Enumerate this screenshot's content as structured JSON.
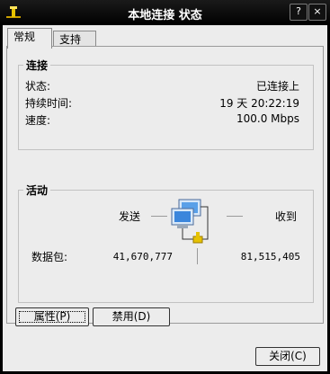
{
  "window": {
    "title": "本地连接 状态",
    "controls": {
      "help": "?",
      "close": "×"
    }
  },
  "tabs": [
    {
      "label": "常规",
      "active": true
    },
    {
      "label": "支持",
      "active": false
    }
  ],
  "connection": {
    "group_title": "连接",
    "status_label": "状态:",
    "status_value": "已连接上",
    "duration_label": "持续时间:",
    "duration_value": "19 天 20:22:19",
    "speed_label": "速度:",
    "speed_value": "100.0 Mbps"
  },
  "activity": {
    "group_title": "活动",
    "sent_label": "发送",
    "received_label": "收到",
    "packets_label": "数据包:",
    "packets_sent": "41,670,777",
    "packets_received": "81,515,405",
    "icon": "network-computers-icon"
  },
  "buttons": {
    "properties": "属性(P)",
    "disable": "禁用(D)",
    "close": "关闭(C)"
  },
  "colors": {
    "window_background": "#ececec",
    "titlebar": "#000000",
    "title_text": "#ffffff"
  }
}
